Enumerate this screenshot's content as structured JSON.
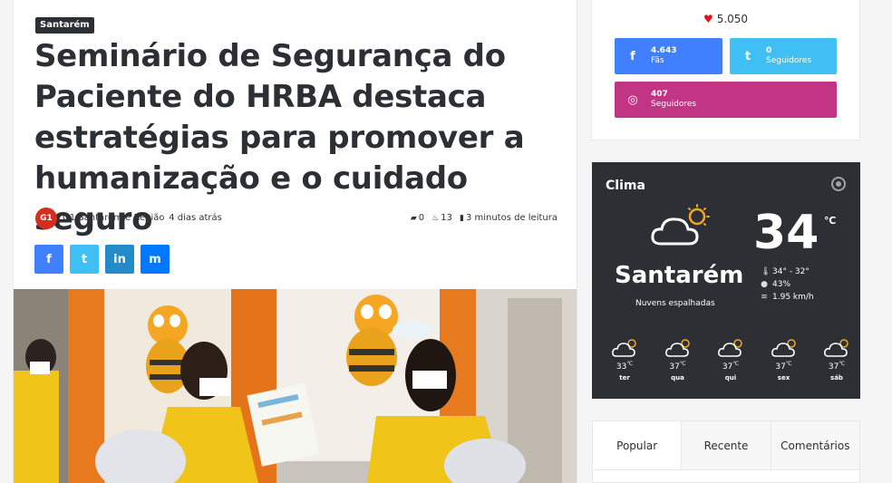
{
  "article": {
    "category": "Santarém",
    "title": "Seminário de Segurança do Paciente do HRBA destaca estratégias para promover a humanização e o cuidado seguro",
    "author_avatar": "G1",
    "author": "G1 Santarém e Região",
    "date": "4 dias atrás",
    "comments": "0",
    "views": "13",
    "read_time": "3 minutos de leitura",
    "share": [
      {
        "icon": "facebook-icon",
        "glyph": "f"
      },
      {
        "icon": "twitter-icon",
        "glyph": "t"
      },
      {
        "icon": "linkedin-icon",
        "glyph": "in"
      },
      {
        "icon": "messenger-icon",
        "glyph": "m"
      }
    ]
  },
  "social": {
    "likes": "5.050",
    "facebook": {
      "count": "4.643",
      "label": "Fãs",
      "glyph": "f"
    },
    "twitter": {
      "count": "0",
      "label": "Seguidores",
      "glyph": "t"
    },
    "instagram": {
      "count": "407",
      "label": "Seguidores",
      "glyph": "◎"
    },
    "colors": {
      "facebook": "#4080ff",
      "twitter": "#40bff5",
      "instagram": "#c13584",
      "heart": "#e0131d"
    }
  },
  "weather": {
    "title": "Clima",
    "temp": "34",
    "unit": "℃",
    "city": "Santarém",
    "description": "Nuvens espalhadas",
    "range": "34° - 32°",
    "humidity": "43%",
    "wind": "1.95 km/h",
    "forecast": [
      {
        "temp": "33",
        "unit": "℃",
        "day": "ter"
      },
      {
        "temp": "37",
        "unit": "℃",
        "day": "qua"
      },
      {
        "temp": "37",
        "unit": "℃",
        "day": "qui"
      },
      {
        "temp": "37",
        "unit": "℃",
        "day": "sex"
      },
      {
        "temp": "37",
        "unit": "℃",
        "day": "sáb"
      }
    ]
  },
  "tabs": [
    "Popular",
    "Recente",
    "Comentários"
  ]
}
